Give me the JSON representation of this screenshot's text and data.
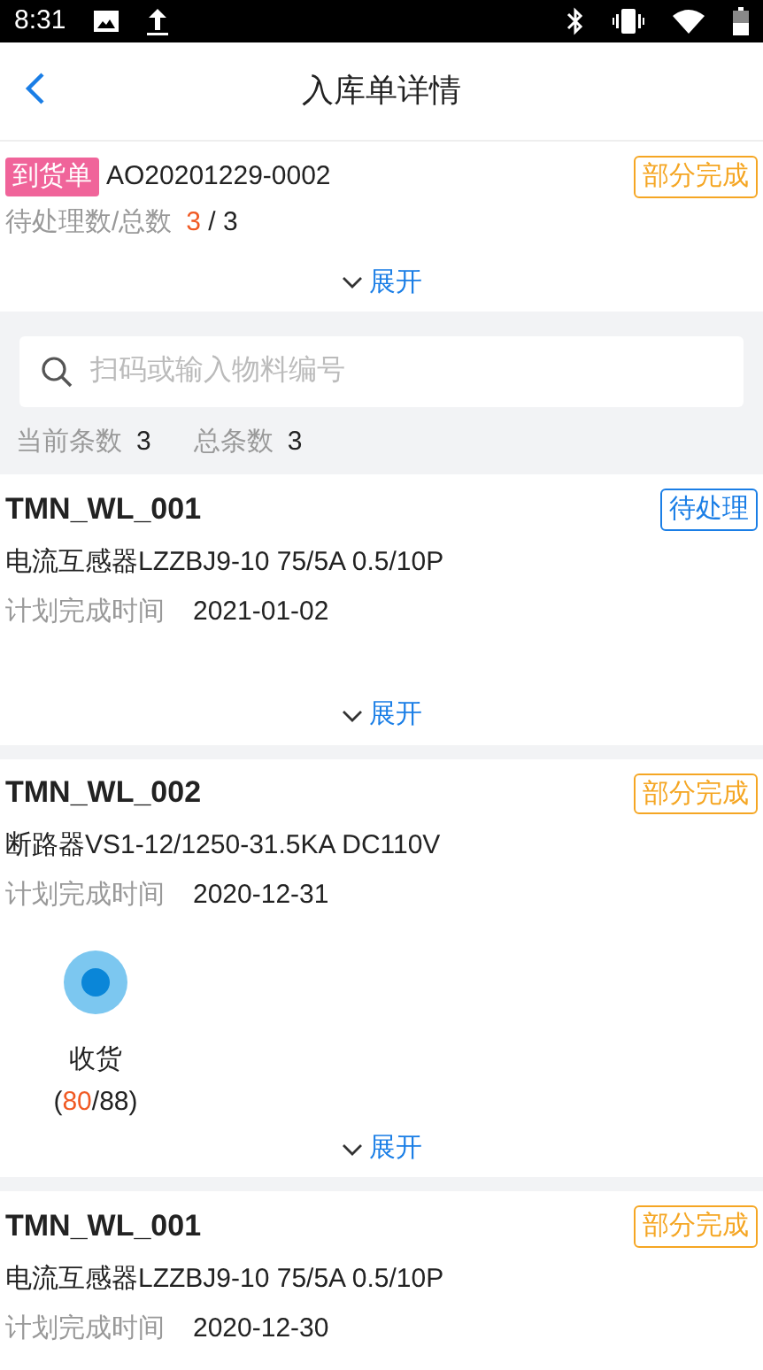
{
  "status_bar": {
    "time": "8:31"
  },
  "header": {
    "title": "入库单详情"
  },
  "order": {
    "tag": "到货单",
    "number": "AO20201229-0002",
    "status": {
      "label": "部分完成",
      "kind": "partial"
    },
    "count_label": "待处理数/总数",
    "count_parts": [
      {
        "text": "3",
        "highlight": true
      },
      {
        "text": " / 3",
        "highlight": false
      }
    ],
    "expand": {
      "label": "展开",
      "expanded": false
    }
  },
  "search": {
    "placeholder": "扫码或输入物料编号"
  },
  "summary": [
    {
      "label": "当前条数",
      "value": "3"
    },
    {
      "label": "总条数",
      "value": "3"
    }
  ],
  "items": [
    {
      "code": "TMN_WL_001",
      "status": {
        "label": "待处理",
        "kind": "pending"
      },
      "description": "电流互感器LZZBJ9-10 75/5A 0.5/10P",
      "date_label": "计划完成时间",
      "date": "2021-01-02",
      "expand": {
        "label": "展开",
        "expanded": false
      }
    },
    {
      "code": "TMN_WL_002",
      "status": {
        "label": "部分完成",
        "kind": "partial"
      },
      "description": "断路器VS1-12/1250-31.5KA DC110V",
      "date_label": "计划完成时间",
      "date": "2020-12-31",
      "steps": [
        {
          "label": "收货",
          "count_parts": [
            {
              "text": "(",
              "highlight": false
            },
            {
              "text": "80",
              "highlight": true
            },
            {
              "text": "/88)",
              "highlight": false
            }
          ],
          "active": true
        }
      ],
      "expand": {
        "label": "展开",
        "expanded": false
      }
    },
    {
      "code": "TMN_WL_001",
      "status": {
        "label": "部分完成",
        "kind": "partial"
      },
      "description": "电流互感器LZZBJ9-10 75/5A 0.5/10P",
      "date_label": "计划完成时间",
      "date": "2020-12-30"
    }
  ]
}
